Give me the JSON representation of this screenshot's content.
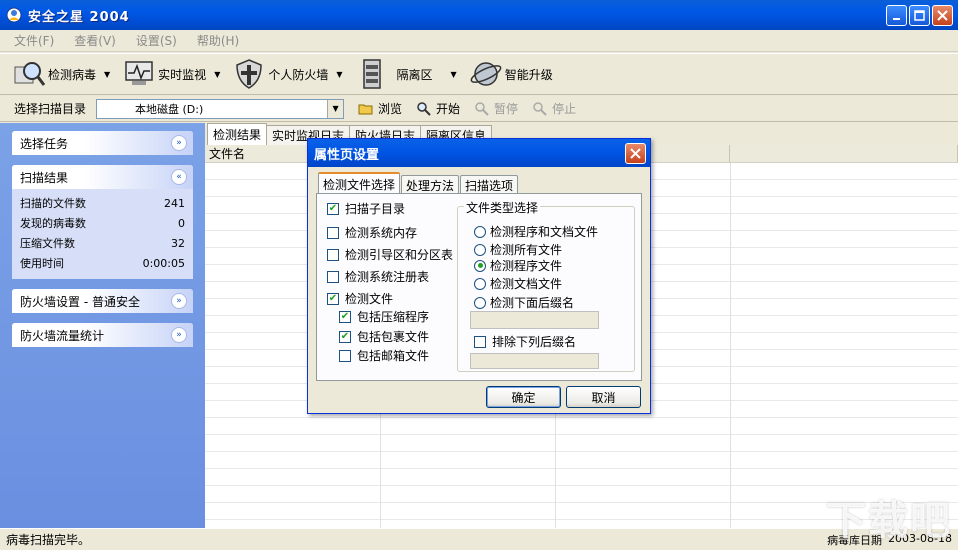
{
  "window": {
    "title": "安全之星 2004"
  },
  "menu": [
    {
      "label": "文件(F)"
    },
    {
      "label": "查看(V)"
    },
    {
      "label": "设置(S)"
    },
    {
      "label": "帮助(H)"
    }
  ],
  "toolbar": {
    "items": [
      {
        "label": "检测病毒",
        "icon": "virus-scan-icon",
        "has_dropdown": true
      },
      {
        "label": "实时监视",
        "icon": "monitor-icon",
        "has_dropdown": true
      },
      {
        "label": "个人防火墙",
        "icon": "shield-icon",
        "has_dropdown": true
      },
      {
        "label": "隔离区",
        "icon": "quarantine-icon",
        "has_dropdown": true
      },
      {
        "label": "智能升级",
        "icon": "update-icon",
        "has_dropdown": false
      }
    ]
  },
  "scanbar": {
    "label": "选择扫描目录",
    "path": "本地磁盘 (D:)",
    "browse": "浏览",
    "start": "开始",
    "pause": "暂停",
    "stop": "停止"
  },
  "left_panel": {
    "select_task": "选择任务",
    "scan_results": {
      "title": "扫描结果",
      "rows": [
        {
          "label": "扫描的文件数",
          "value": "241"
        },
        {
          "label": "发现的病毒数",
          "value": "0"
        },
        {
          "label": "压缩文件数",
          "value": "32"
        },
        {
          "label": "使用时间",
          "value": "0:00:05"
        }
      ]
    },
    "firewall_settings": "防火墙设置 - 普通安全",
    "firewall_traffic": "防火墙流量统计"
  },
  "main": {
    "tabs": [
      "检测结果",
      "实时监视日志",
      "防火墙日志",
      "隔离区信息"
    ],
    "columns": [
      "文件名",
      "",
      "",
      ""
    ]
  },
  "dialog": {
    "title": "属性页设置",
    "tabs": [
      "检测文件选择",
      "处理方法",
      "扫描选项"
    ],
    "checks": [
      {
        "label": "扫描子目录",
        "checked": true
      },
      {
        "label": "检测系统内存",
        "checked": false
      },
      {
        "label": "检测引导区和分区表",
        "checked": false
      },
      {
        "label": "检测系统注册表",
        "checked": false
      },
      {
        "label": "检测文件",
        "checked": true
      },
      {
        "label": "包括压缩程序",
        "checked": true
      },
      {
        "label": "包括包裹文件",
        "checked": true
      },
      {
        "label": "包括邮箱文件",
        "checked": false
      }
    ],
    "filetype_group": "文件类型选择",
    "radios": [
      {
        "label": "检测程序和文档文件",
        "selected": false
      },
      {
        "label": "检测所有文件",
        "selected": false
      },
      {
        "label": "检测程序文件",
        "selected": true
      },
      {
        "label": "检测文档文件",
        "selected": false
      },
      {
        "label": "检测下面后缀名",
        "selected": false
      }
    ],
    "exclude_label": "排除下列后缀名",
    "ok": "确定",
    "cancel": "取消"
  },
  "status": {
    "message": "病毒扫描完毕。",
    "db_label": "病毒库日期",
    "db_date": "2003-08-18"
  },
  "watermark": "下载吧"
}
